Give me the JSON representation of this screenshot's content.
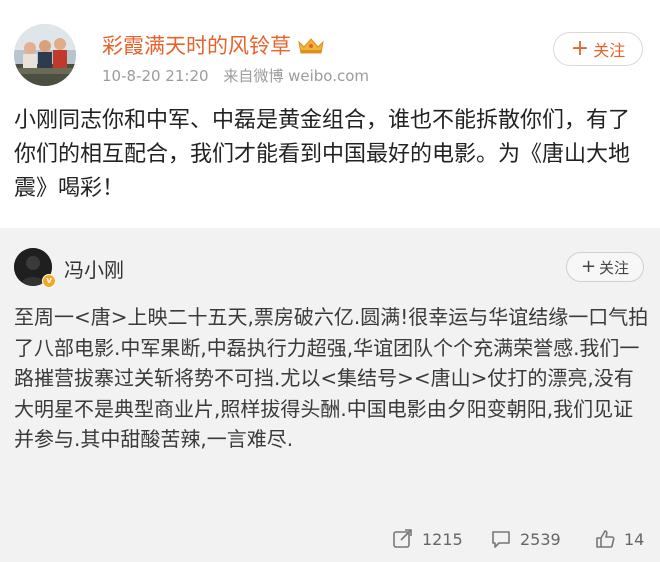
{
  "post": {
    "username": "彩霞满天时的风铃草",
    "timestamp": "10-8-20 21:20",
    "source": "来自微博 weibo.com",
    "follow_label": "关注",
    "text": "小刚同志你和中军、中磊是黄金组合，谁也不能拆散你们，有了你们的相互配合，我们才能看到中国最好的电影。为《唐山大地震》喝彩！"
  },
  "repost": {
    "username": "冯小刚",
    "follow_label": "关注",
    "text": "至周一<唐>上映二十五天,票房破六亿.圆满!很幸运与华谊结缘一口气拍了八部电影.中军果断,中磊执行力超强,华谊团队个个充满荣誉感.我们一路摧营拔寨过关斩将势不可挡.尤以<集结号><唐山>仗打的漂亮,没有大明星不是典型商业片,照样拔得头酬.中国电影由夕阳变朝阳,我们见证并参与.其中甜酸苦辣,一言难尽.",
    "actions": {
      "repost_count": "1215",
      "comment_count": "2539",
      "like_count": "14"
    }
  },
  "colors": {
    "accent": "#e8632b",
    "badge": "#f5a623",
    "repost_bg": "#f2f2f2"
  },
  "icons": [
    "crown-icon",
    "plus-icon",
    "verified-badge-icon",
    "repost-icon",
    "comment-icon",
    "like-icon"
  ]
}
